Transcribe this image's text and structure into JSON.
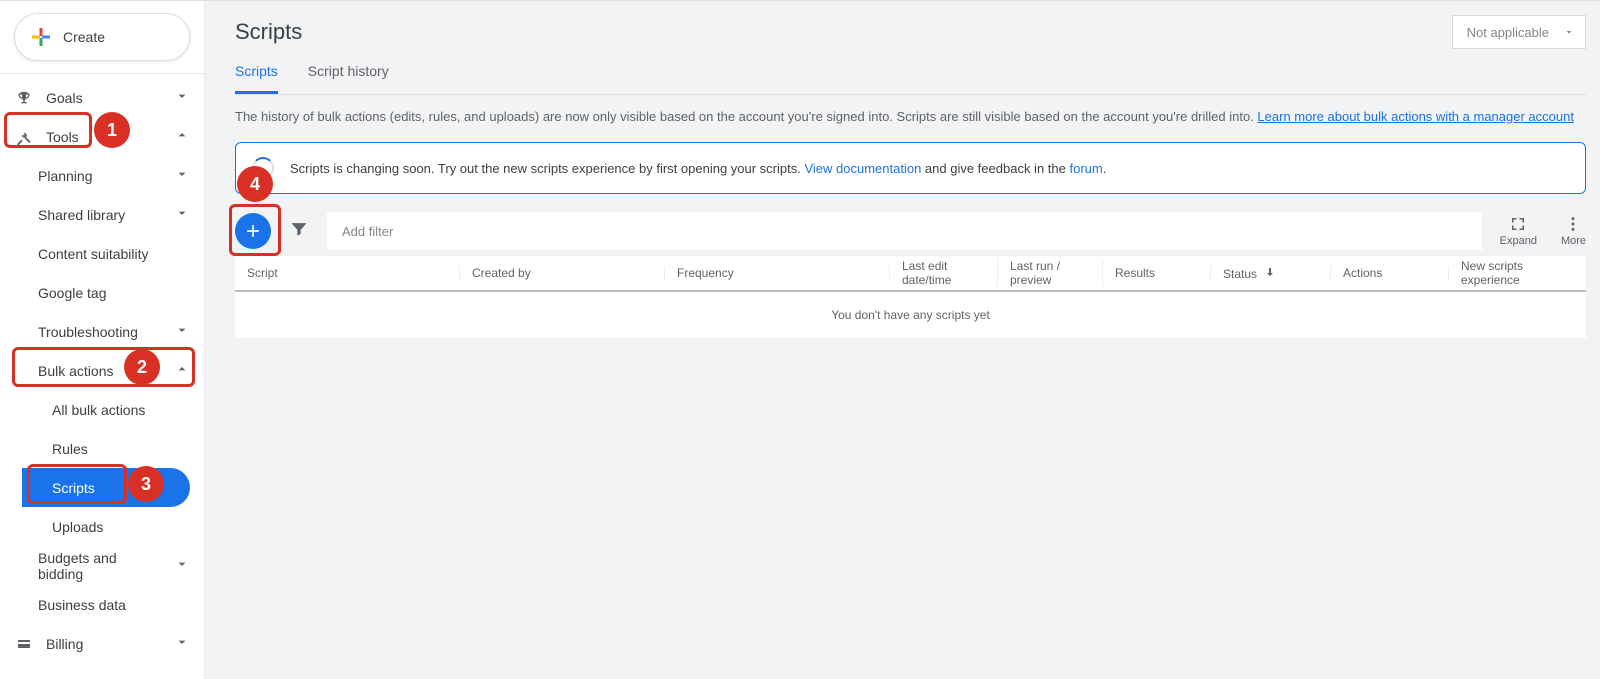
{
  "sidebar": {
    "create_label": "Create",
    "goals": "Goals",
    "tools": "Tools",
    "planning": "Planning",
    "shared_library": "Shared library",
    "content_suitability": "Content suitability",
    "google_tag": "Google tag",
    "troubleshooting": "Troubleshooting",
    "bulk_actions": "Bulk actions",
    "all_bulk": "All bulk actions",
    "rules": "Rules",
    "scripts": "Scripts",
    "uploads": "Uploads",
    "budgets": "Budgets and bidding",
    "business_data": "Business data",
    "billing": "Billing"
  },
  "callouts": {
    "1": "1",
    "2": "2",
    "3": "3",
    "4": "4"
  },
  "header": {
    "title": "Scripts",
    "dropdown": "Not applicable"
  },
  "tabs": {
    "scripts": "Scripts",
    "history": "Script history"
  },
  "info": {
    "prefix": "The history of bulk actions (edits, rules, and uploads) are now only visible based on the account you're signed into. Scripts are still visible based on the account you're drilled into. ",
    "link": "Learn more about bulk actions with a manager account"
  },
  "banner": {
    "t1": "Scripts is changing soon. Try out the new scripts experience by first opening your scripts. ",
    "link1": "View documentation",
    "t2": " and give feedback in the ",
    "link2": "forum",
    "t3": "."
  },
  "toolbar": {
    "add_filter": "Add filter",
    "expand": "Expand",
    "more": "More"
  },
  "table": {
    "headers": {
      "script": "Script",
      "created_by": "Created by",
      "frequency": "Frequency",
      "last_edit": "Last edit date/time",
      "last_run": "Last run / preview",
      "results": "Results",
      "status": "Status",
      "actions": "Actions",
      "new_scripts": "New scripts experience"
    },
    "empty": "You don't have any scripts yet"
  }
}
